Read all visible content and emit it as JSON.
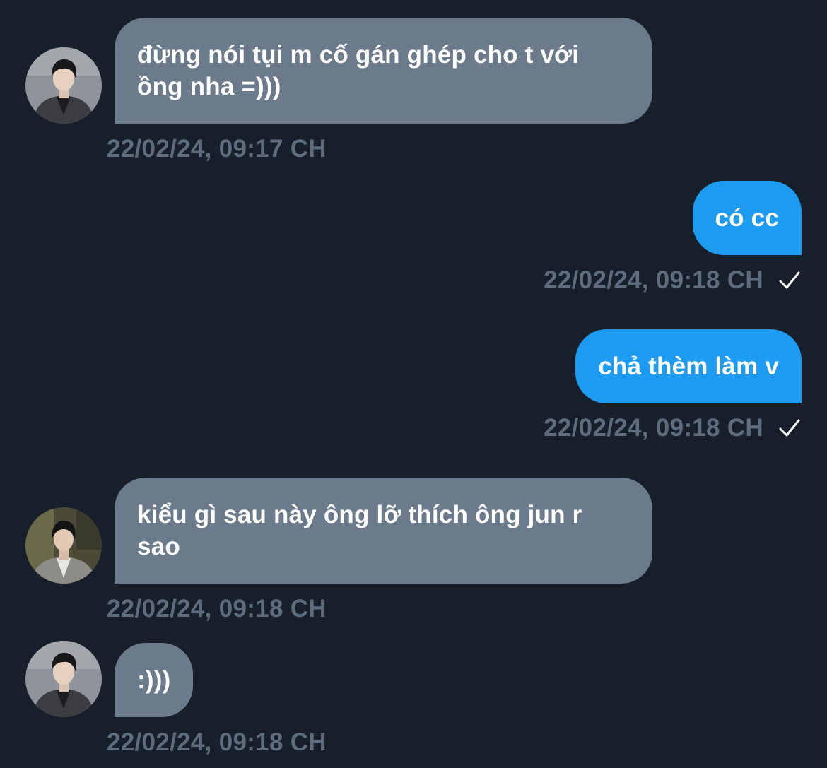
{
  "messages": [
    {
      "direction": "incoming",
      "avatar_icon": "user-avatar-1",
      "text": "đừng nói tụi m cố gán ghép cho t với ồng nha =)))",
      "timestamp": "22/02/24, 09:17 CH"
    },
    {
      "direction": "outgoing",
      "text": "có cc",
      "timestamp": "22/02/24, 09:18 CH",
      "status_icon": "check-icon"
    },
    {
      "direction": "outgoing",
      "text": "chả thèm làm v",
      "timestamp": "22/02/24, 09:18 CH",
      "status_icon": "check-icon"
    },
    {
      "direction": "incoming",
      "avatar_icon": "user-avatar-2",
      "text": "kiểu gì sau này ông lỡ thích ông jun r sao",
      "timestamp": "22/02/24, 09:18 CH"
    },
    {
      "direction": "incoming",
      "avatar_icon": "user-avatar-1",
      "text": ":)))",
      "timestamp": "22/02/24, 09:18 CH"
    }
  ],
  "colors": {
    "background": "#17202a",
    "incoming_bubble": "#6b7b8b",
    "outgoing_bubble": "#1d9bf0",
    "timestamp": "#5e6d7e",
    "text": "#ffffff"
  }
}
